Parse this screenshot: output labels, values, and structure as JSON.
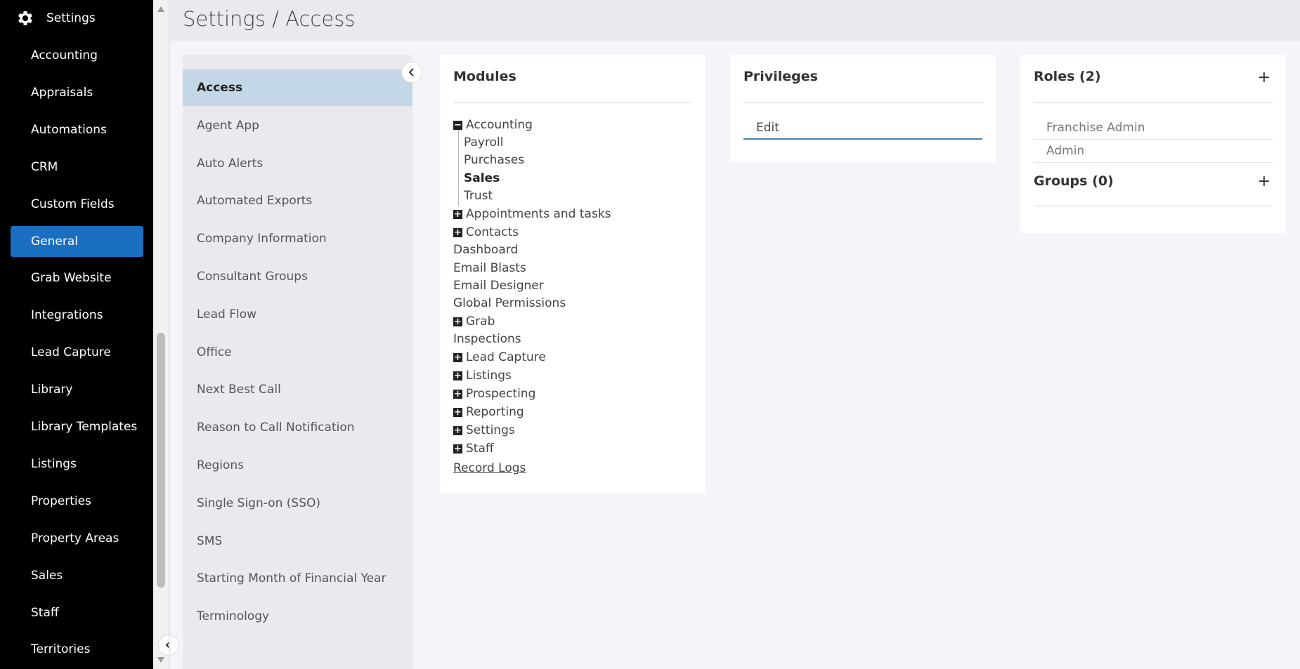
{
  "sidebar": {
    "brand_label": "Settings",
    "brand_icon": "gear-icon",
    "items": [
      {
        "label": "Accounting"
      },
      {
        "label": "Appraisals"
      },
      {
        "label": "Automations"
      },
      {
        "label": "CRM"
      },
      {
        "label": "Custom Fields"
      },
      {
        "label": "General",
        "active": true
      },
      {
        "label": "Grab Website"
      },
      {
        "label": "Integrations"
      },
      {
        "label": "Lead Capture"
      },
      {
        "label": "Library"
      },
      {
        "label": "Library Templates"
      },
      {
        "label": "Listings"
      },
      {
        "label": "Properties"
      },
      {
        "label": "Property Areas"
      },
      {
        "label": "Sales"
      },
      {
        "label": "Staff"
      },
      {
        "label": "Territories"
      }
    ],
    "active_color": "#1a6fc0"
  },
  "header": {
    "title": "Settings / Access"
  },
  "submenu": {
    "items": [
      {
        "label": "Access",
        "active": true
      },
      {
        "label": "Agent App"
      },
      {
        "label": "Auto Alerts"
      },
      {
        "label": "Automated Exports"
      },
      {
        "label": "Company Information"
      },
      {
        "label": "Consultant Groups"
      },
      {
        "label": "Lead Flow"
      },
      {
        "label": "Office"
      },
      {
        "label": "Next Best Call"
      },
      {
        "label": "Reason to Call Notification"
      },
      {
        "label": "Regions"
      },
      {
        "label": "Single Sign-on (SSO)"
      },
      {
        "label": "SMS"
      },
      {
        "label": "Starting Month of Financial Year"
      },
      {
        "label": "Terminology"
      }
    ]
  },
  "modules": {
    "title": "Modules",
    "tree": [
      {
        "label": "Accounting",
        "toggle": "−",
        "expanded": true
      },
      {
        "label": "Payroll",
        "child": true
      },
      {
        "label": "Purchases",
        "child": true
      },
      {
        "label": "Sales",
        "child": true,
        "selected": true
      },
      {
        "label": "Trust",
        "child": true
      },
      {
        "label": "Appointments and tasks",
        "toggle": "+"
      },
      {
        "label": "Contacts",
        "toggle": "+"
      },
      {
        "label": "Dashboard"
      },
      {
        "label": "Email Blasts"
      },
      {
        "label": "Email Designer"
      },
      {
        "label": "Global Permissions"
      },
      {
        "label": "Grab",
        "toggle": "+"
      },
      {
        "label": "Inspections"
      },
      {
        "label": "Lead Capture",
        "toggle": "+"
      },
      {
        "label": "Listings",
        "toggle": "+"
      },
      {
        "label": "Prospecting",
        "toggle": "+"
      },
      {
        "label": "Reporting",
        "toggle": "+"
      },
      {
        "label": "Settings",
        "toggle": "+"
      },
      {
        "label": "Staff",
        "toggle": "+"
      },
      {
        "label": "Record Logs",
        "link": true
      }
    ]
  },
  "privileges": {
    "title": "Privileges",
    "items": [
      "Edit"
    ]
  },
  "roles": {
    "title": "Roles (2)",
    "add_label": "+",
    "items": [
      "Franchise Admin",
      "Admin"
    ]
  },
  "groups": {
    "title": "Groups (0)",
    "add_label": "+"
  }
}
